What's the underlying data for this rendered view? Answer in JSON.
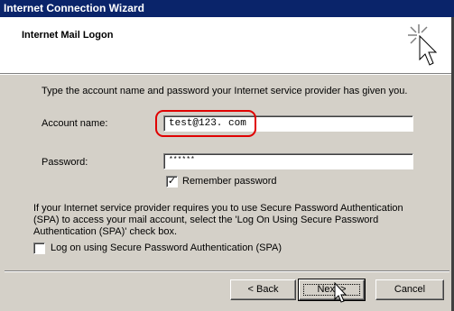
{
  "window": {
    "title": "Internet Connection Wizard"
  },
  "header": {
    "title": "Internet Mail Logon"
  },
  "intro": "Type the account name and password your Internet service provider has given you.",
  "account": {
    "label": "Account name:",
    "value": "test@123. com"
  },
  "password": {
    "label": "Password:",
    "value": "******"
  },
  "remember": {
    "label": "Remember password",
    "checked": true
  },
  "spa": {
    "info_line1": "If your Internet service provider requires you to use Secure Password Authentication",
    "info_line2": "(SPA) to access your mail account, select the 'Log On Using Secure Password",
    "info_line3": "Authentication (SPA)' check box.",
    "checkbox_label": "Log on using Secure Password Authentication (SPA)",
    "checked": false
  },
  "buttons": {
    "back": "< Back",
    "next": "Next >",
    "cancel": "Cancel"
  },
  "colors": {
    "titlebar": "#0a246a",
    "highlight": "#e00000",
    "face": "#d4d0c8"
  },
  "icons": {
    "wizard": "wizard-star-cursor-icon",
    "check": "check-icon",
    "cursor": "mouse-pointer-icon"
  }
}
